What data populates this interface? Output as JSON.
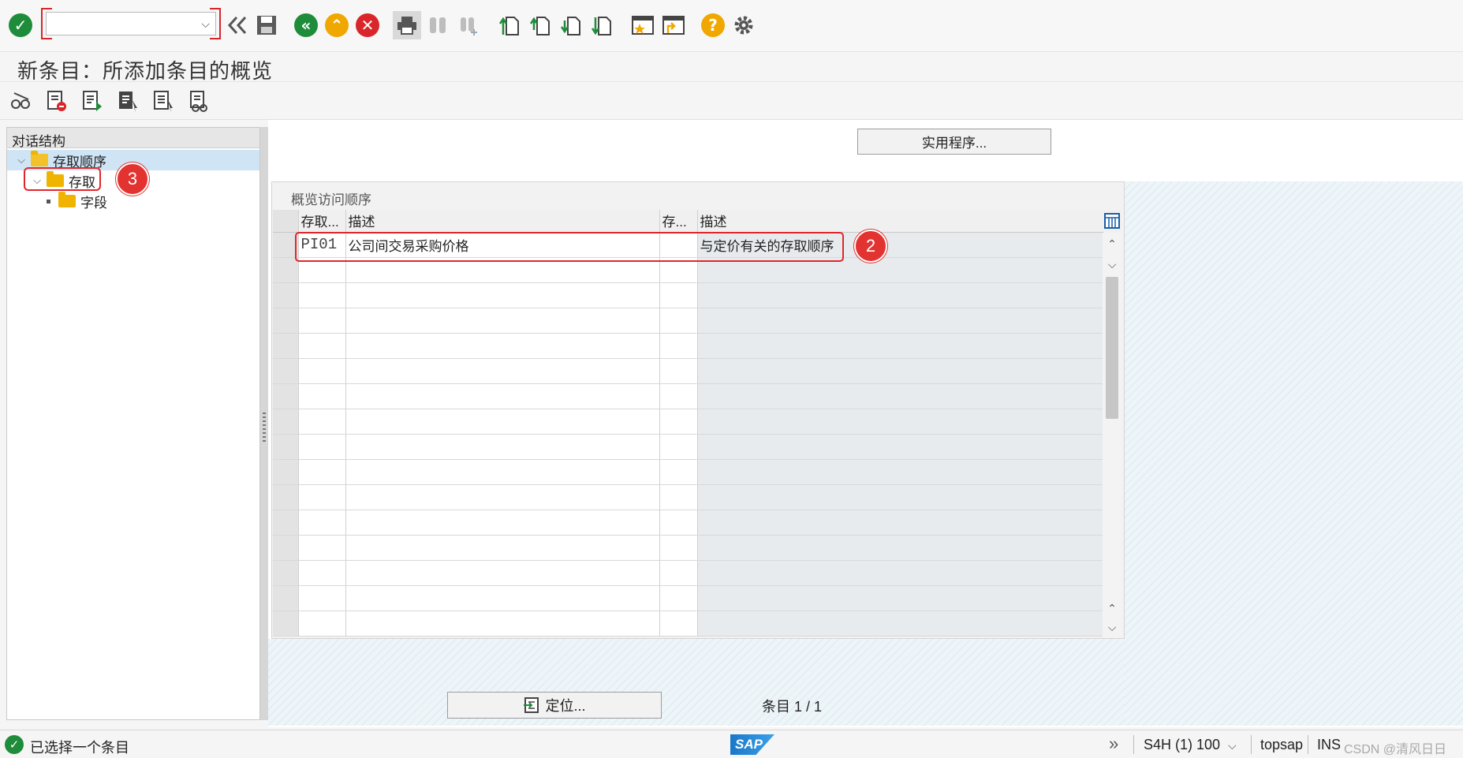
{
  "toolbar": {
    "command_value": "",
    "icons": [
      "enter-icon",
      "back-history-icon",
      "save-icon",
      "back-icon",
      "exit-icon",
      "cancel-icon",
      "print-icon",
      "find-icon",
      "find-next-icon",
      "first-page-icon",
      "previous-page-icon",
      "next-page-icon",
      "last-page-icon",
      "create-session-icon",
      "shortcut-icon",
      "help-icon",
      "settings-icon"
    ]
  },
  "title": "新条目：所添加条目的概览",
  "tree": {
    "header": "对话结构",
    "items": [
      {
        "label": "存取顺序",
        "level": 0,
        "expanded": true
      },
      {
        "label": "存取",
        "level": 1,
        "expanded": true
      },
      {
        "label": "字段",
        "level": 2
      }
    ]
  },
  "main": {
    "utilities_button": "实用程序...",
    "panel_title": "概览访问顺序",
    "columns": [
      "存取...",
      "描述",
      "存...",
      "描述"
    ],
    "rows": [
      {
        "access_seq": "PI01",
        "description": "公司间交易采购价格",
        "access_type": "",
        "type_description": "与定价有关的存取顺序"
      }
    ],
    "position_button": "定位...",
    "entry_label": "条目",
    "entry_count": "1 / 1"
  },
  "annotations": {
    "badge_2": "2",
    "badge_3": "3"
  },
  "status": {
    "message": "已选择一个条目",
    "logo": "SAP",
    "system": "S4H (1) 100",
    "server": "topsap",
    "mode": "INS",
    "watermark": "CSDN @清风日日"
  },
  "colors": {
    "accent_red": "#e1262b",
    "sap_blue": "#1b77c9",
    "ok_green": "#1e8c3a"
  }
}
